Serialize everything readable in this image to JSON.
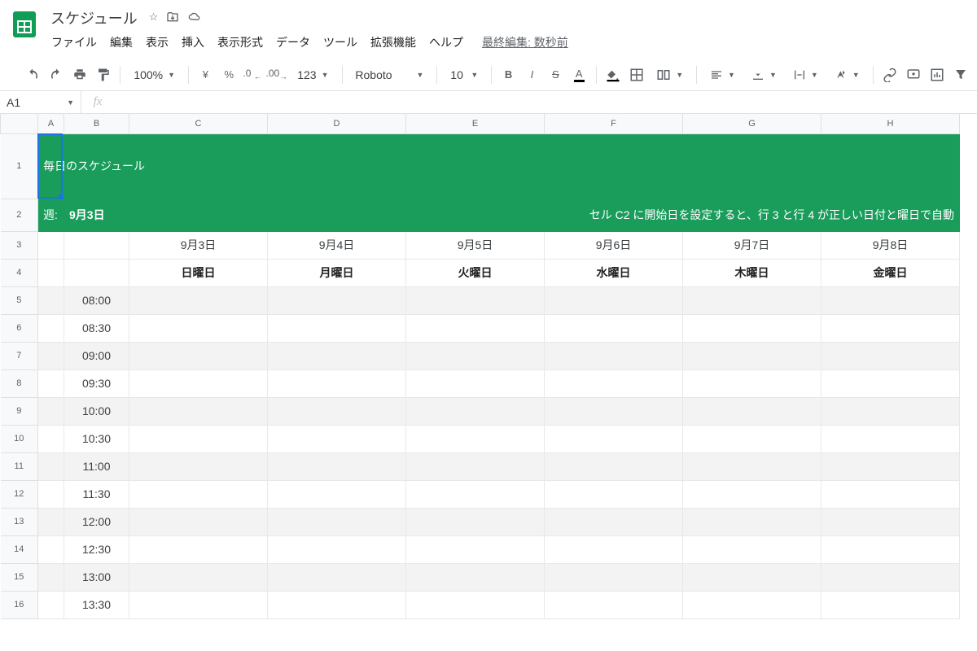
{
  "doc": {
    "title": "スケジュール",
    "last_edit": "最終編集: 数秒前"
  },
  "menu": {
    "file": "ファイル",
    "edit": "編集",
    "view": "表示",
    "insert": "挿入",
    "format": "表示形式",
    "data": "データ",
    "tools": "ツール",
    "extensions": "拡張機能",
    "help": "ヘルプ"
  },
  "toolbar": {
    "zoom": "100%",
    "currency": "¥",
    "percent": "%",
    "dec_dec": ".0",
    "inc_dec": ".00",
    "more_num": "123",
    "font": "Roboto",
    "size": "10"
  },
  "namebox": "A1",
  "sheet": {
    "columns": [
      "A",
      "B",
      "C",
      "D",
      "E",
      "F",
      "G",
      "H"
    ],
    "title": "毎日のスケジュール",
    "week_label": "週:",
    "week_date": "9月3日",
    "hint": "セル C2 に開始日を設定すると、行 3 と行 4 が正しい日付と曜日で自動",
    "dates": [
      "9月3日",
      "9月4日",
      "9月5日",
      "9月6日",
      "9月7日",
      "9月8日"
    ],
    "days": [
      "日曜日",
      "月曜日",
      "火曜日",
      "水曜日",
      "木曜日",
      "金曜日"
    ],
    "times": [
      "08:00",
      "08:30",
      "09:00",
      "09:30",
      "10:00",
      "10:30",
      "11:00",
      "11:30",
      "12:00",
      "12:30",
      "13:00",
      "13:30"
    ]
  }
}
